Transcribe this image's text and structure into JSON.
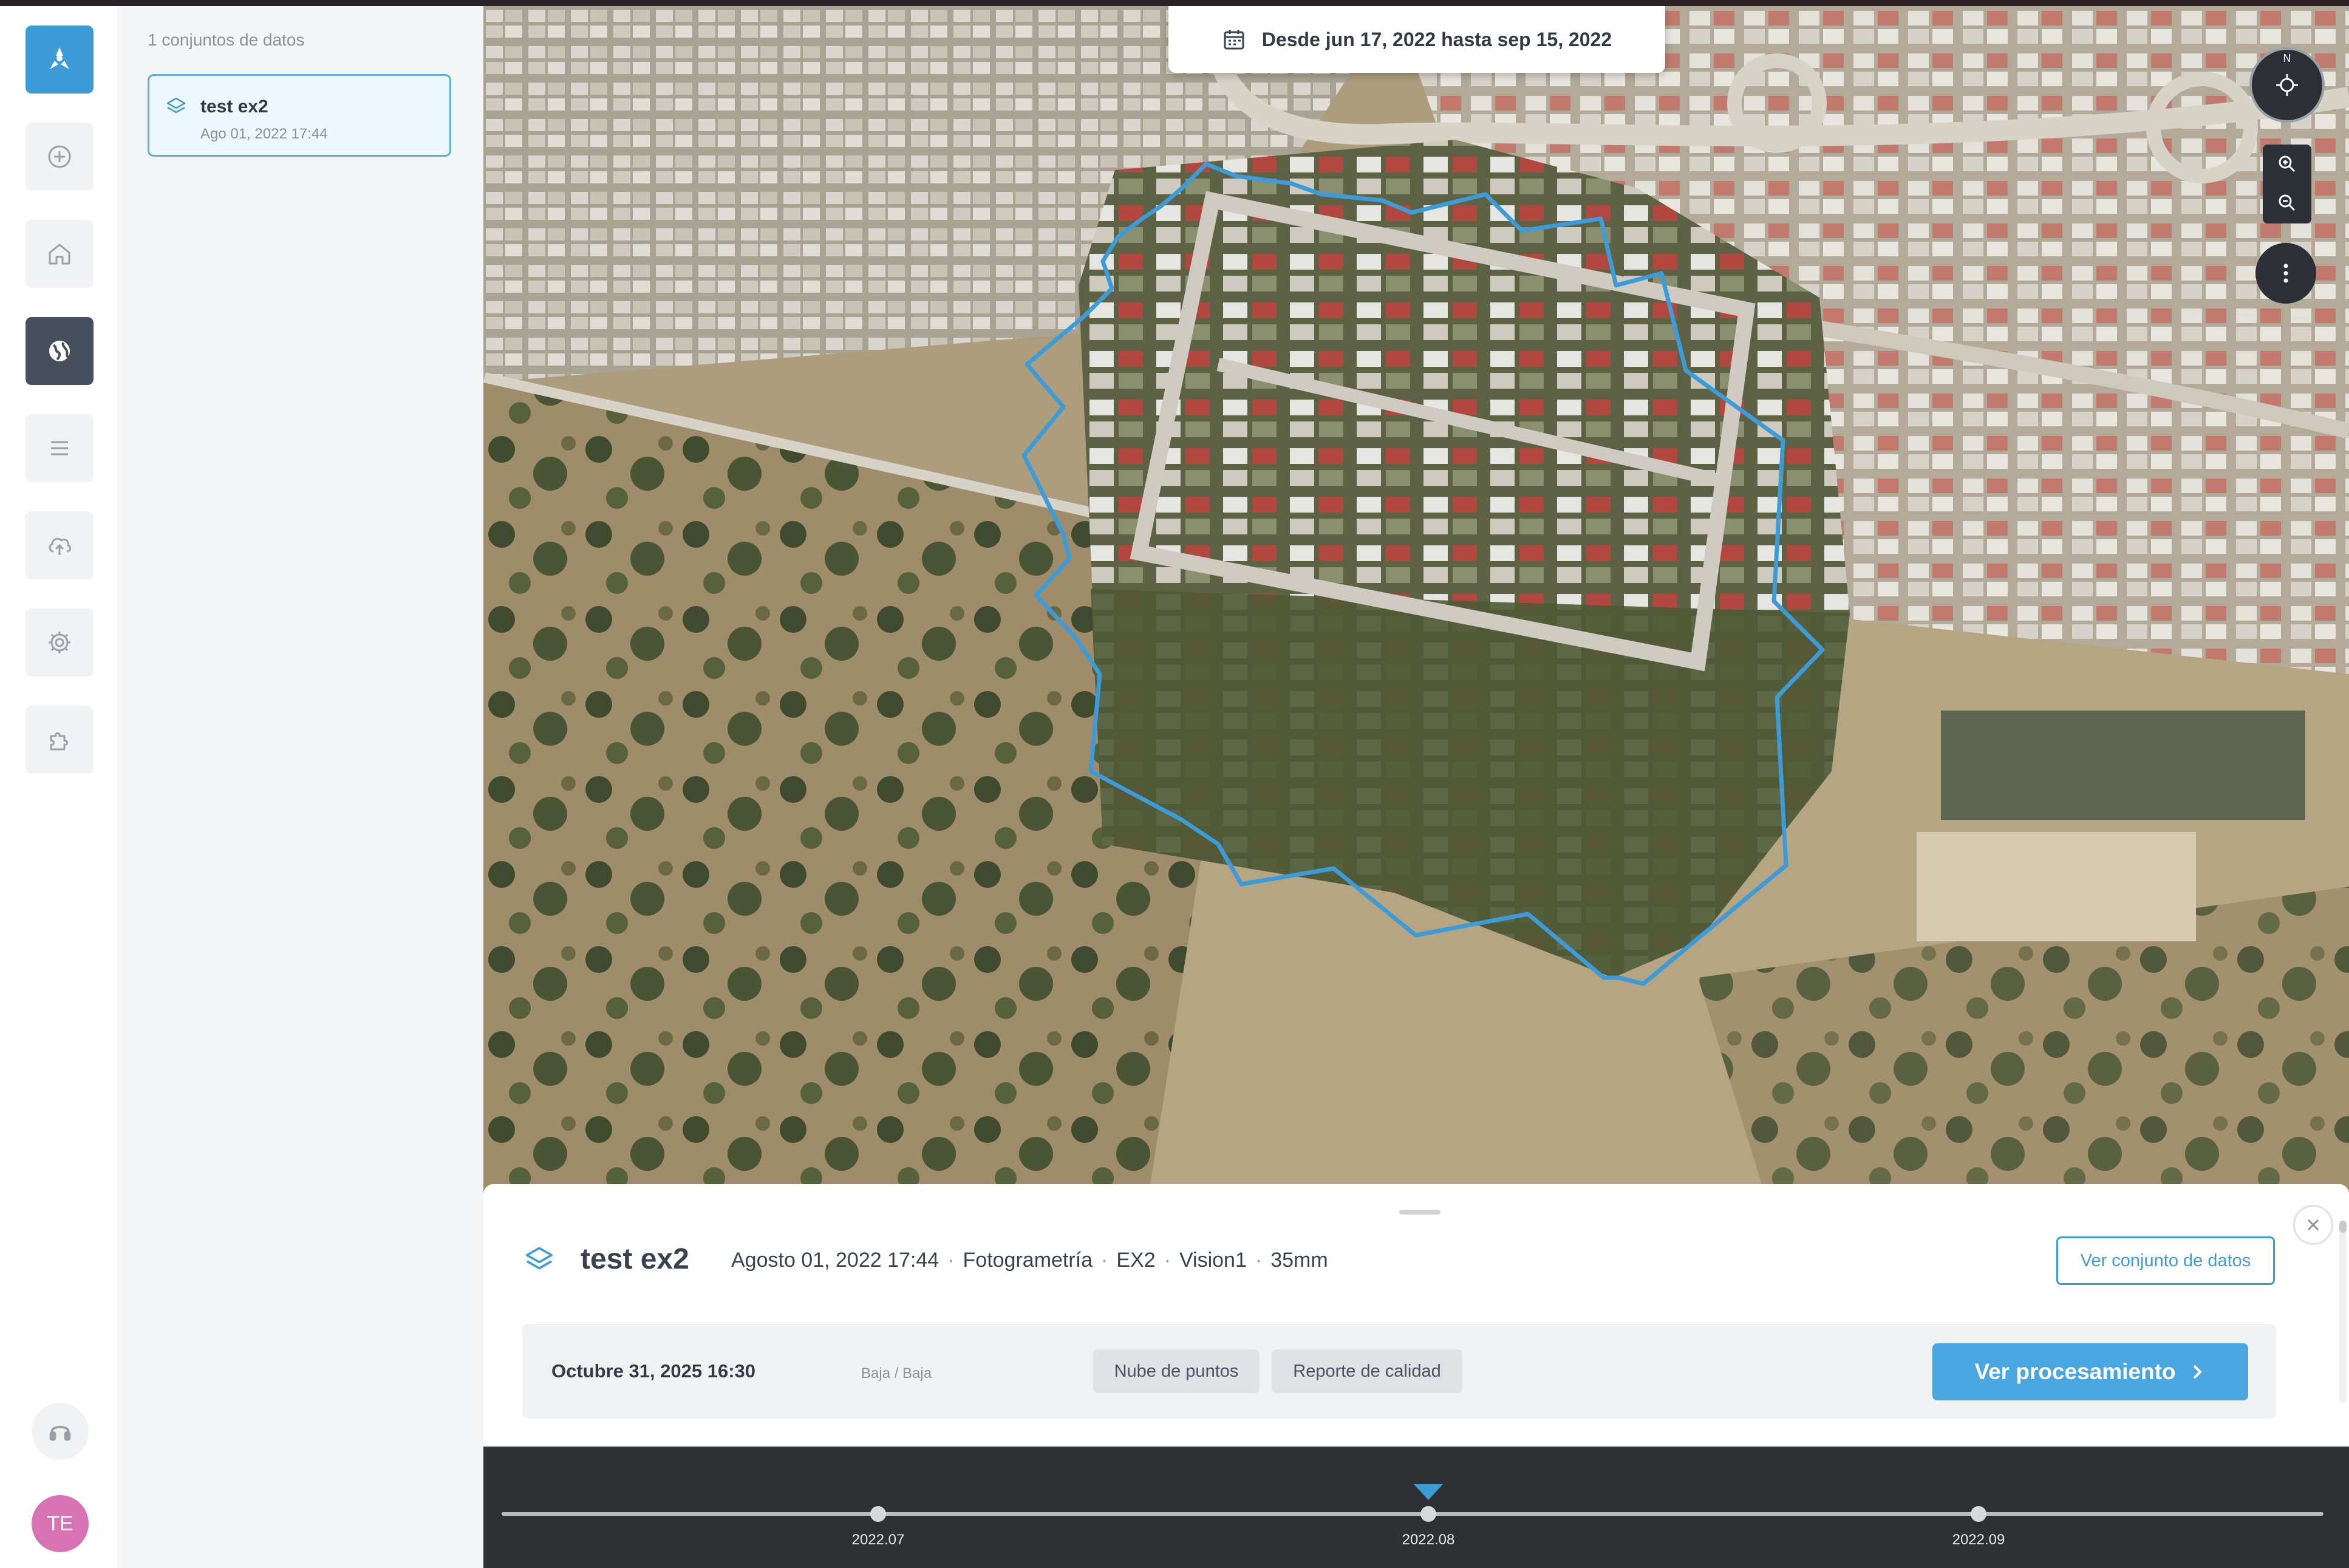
{
  "sidebar": {
    "items": [
      {
        "icon": "app-logo-icon",
        "active": false
      },
      {
        "icon": "plus-circle-icon",
        "active": false
      },
      {
        "icon": "home-icon",
        "active": false
      },
      {
        "icon": "globe-icon",
        "active": true
      },
      {
        "icon": "list-icon",
        "active": false
      },
      {
        "icon": "cloud-upload-icon",
        "active": false
      },
      {
        "icon": "gear-icon",
        "active": false
      },
      {
        "icon": "puzzle-icon",
        "active": false
      }
    ],
    "support_icon": "headset-icon",
    "avatar": "TE"
  },
  "panel": {
    "count_label": "1 conjuntos de datos",
    "datasets": [
      {
        "name": "test ex2",
        "date": "Ago 01, 2022 17:44",
        "icon": "layers-icon",
        "selected": true
      }
    ]
  },
  "map": {
    "date_range": "Desde jun 17, 2022 hasta sep 15, 2022",
    "compass_label": "N",
    "controls": [
      "locate-icon",
      "zoom-in-icon",
      "zoom-out-icon",
      "more-vertical-icon"
    ],
    "boundary_color": "#3d9bd8"
  },
  "detail": {
    "title": "test ex2",
    "meta": [
      "Agosto 01, 2022 17:44",
      "Fotogrametría",
      "EX2",
      "Vision1",
      "35mm"
    ],
    "view_dataset_label": "Ver conjunto de datos",
    "processing": {
      "date": "Octubre 31, 2025 16:30",
      "quality": "Baja / Baja",
      "chips": [
        "Nube de puntos",
        "Reporte de calidad"
      ],
      "view_label": "Ver procesamiento"
    }
  },
  "timeline": {
    "labels": [
      "2022.07",
      "2022.08",
      "2022.09"
    ],
    "selected": "2022.08"
  },
  "colors": {
    "accent": "#3d9bd8",
    "active_nav": "#474f5e",
    "avatar": "#d873b3"
  }
}
